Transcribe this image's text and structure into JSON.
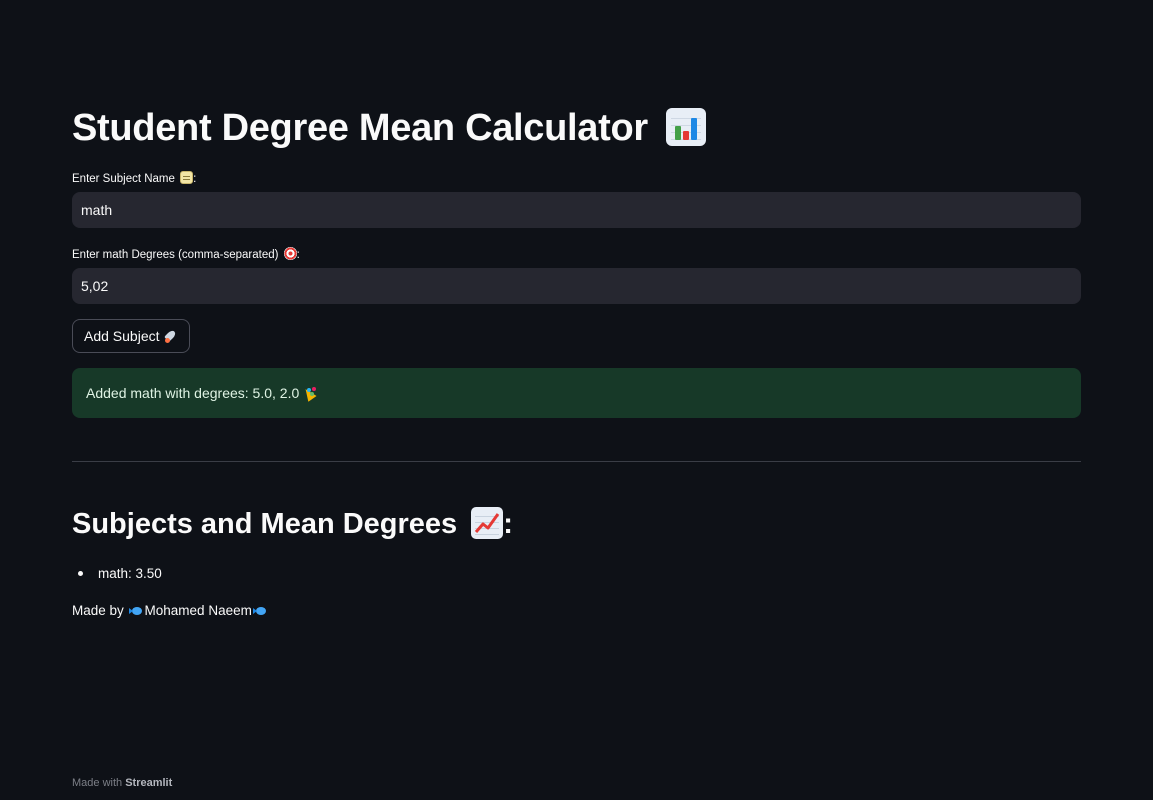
{
  "title": {
    "text": "Student Degree Mean Calculator",
    "icon": "bar-chart-emoji"
  },
  "subject_field": {
    "label": "Enter Subject Name",
    "label_icon": "memo-emoji",
    "label_suffix": ":",
    "value": "math"
  },
  "degrees_field": {
    "label": "Enter math Degrees (comma-separated)",
    "label_icon": "direct-hit-emoji",
    "label_suffix": ":",
    "value": "5,02"
  },
  "add_button": {
    "label": "Add Subject",
    "icon": "rocket-emoji"
  },
  "success_alert": {
    "text": "Added math with degrees: 5.0, 2.0",
    "icon": "party-popper-emoji",
    "color": "#173928"
  },
  "results": {
    "heading": "Subjects and Mean Degrees",
    "heading_icon": "chart-increasing-emoji",
    "heading_suffix": ":",
    "items": [
      {
        "text": "math: 3.50"
      }
    ]
  },
  "credit": {
    "prefix": "Made by ",
    "name": "Mohamed Naeem",
    "icon": "fish-emoji"
  },
  "footer": {
    "prefix": "Made with ",
    "brand": "Streamlit"
  },
  "colors": {
    "background": "#0e1117",
    "input_bg": "#262730",
    "text": "#fafafa"
  }
}
